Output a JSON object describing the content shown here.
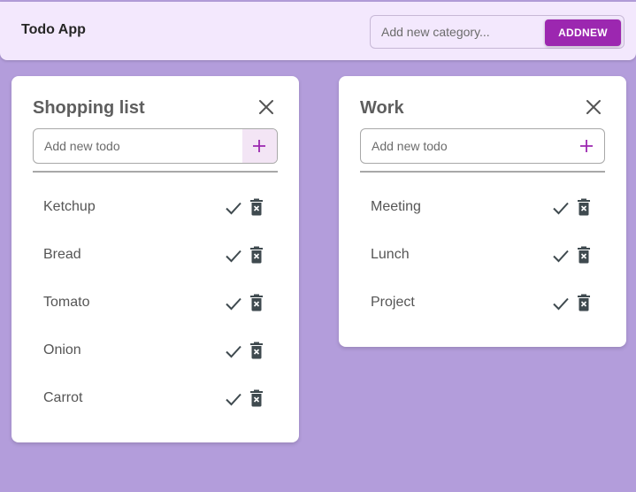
{
  "header": {
    "title": "Todo App",
    "category_placeholder": "Add new category...",
    "add_button": "ADDNEW"
  },
  "colors": {
    "background": "#b39ddb",
    "appbar": "#f3e8fd",
    "accent": "#9c27b0",
    "text_dark": "#5e5e5e"
  },
  "icons": {
    "close": "close-icon",
    "add": "plus-icon",
    "complete": "check-icon",
    "delete": "trash-icon"
  },
  "cards": [
    {
      "title": "Shopping list",
      "input_placeholder": "Add new todo",
      "todos": [
        "Ketchup",
        "Bread",
        "Tomato",
        "Onion",
        "Carrot"
      ]
    },
    {
      "title": "Work",
      "input_placeholder": "Add new todo",
      "todos": [
        "Meeting",
        "Lunch",
        "Project"
      ]
    }
  ]
}
